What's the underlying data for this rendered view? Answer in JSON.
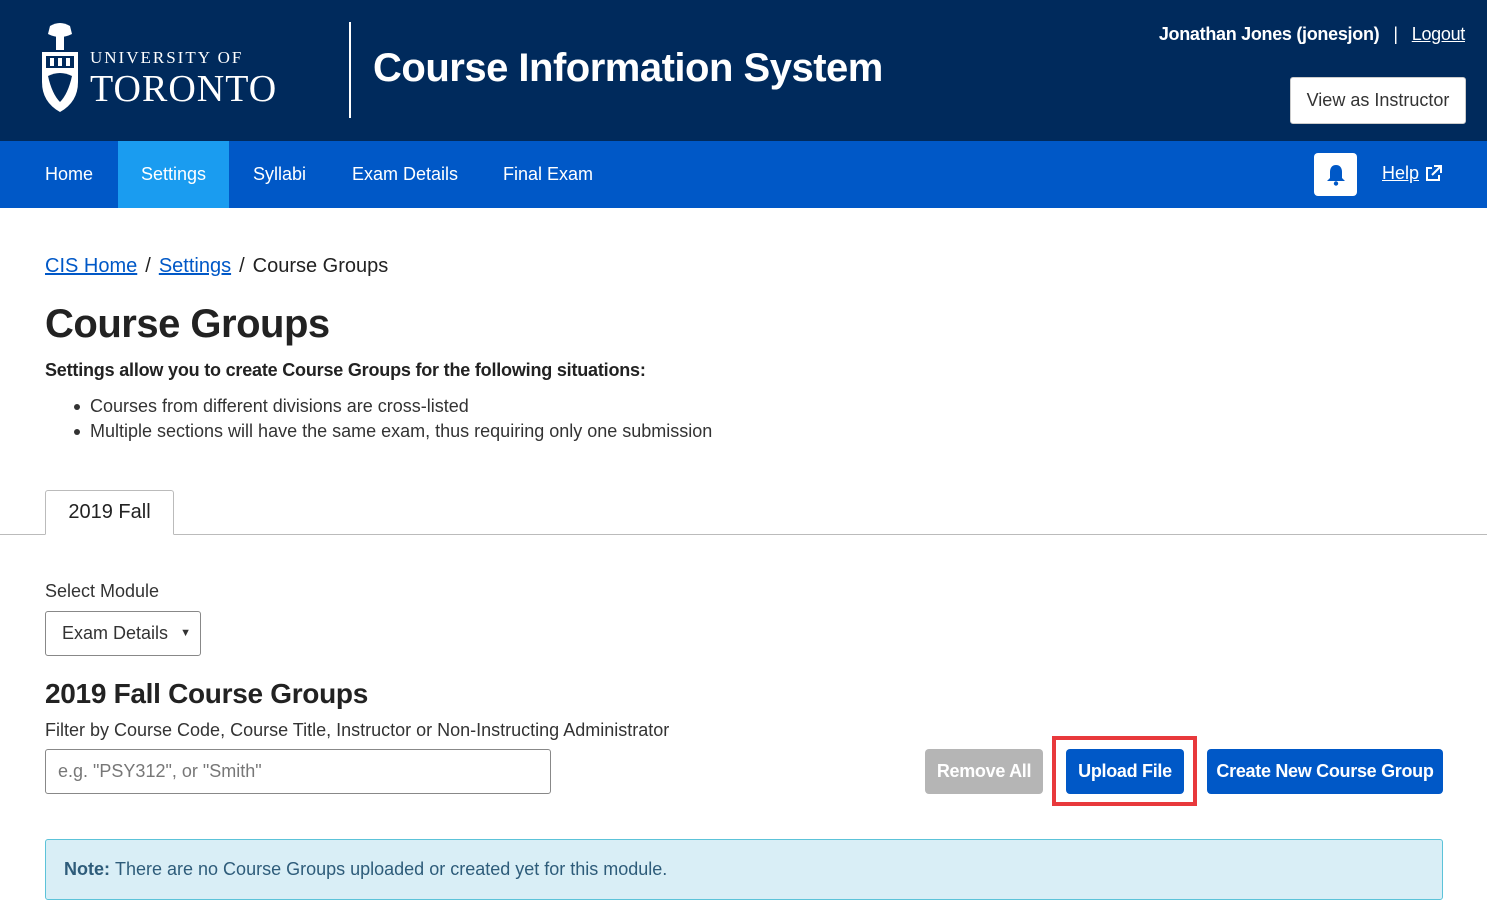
{
  "header": {
    "university_line1": "UNIVERSITY OF",
    "university_line2": "TORONTO",
    "app_title": "Course Information System",
    "user_name": "Jonathan Jones (jonesjon)",
    "separator": "|",
    "logout_label": "Logout",
    "view_as_instructor_label": "View as Instructor"
  },
  "nav": {
    "items": [
      {
        "label": "Home",
        "active": false
      },
      {
        "label": "Settings",
        "active": true
      },
      {
        "label": "Syllabi",
        "active": false
      },
      {
        "label": "Exam Details",
        "active": false
      },
      {
        "label": "Final Exam",
        "active": false
      }
    ],
    "help_label": "Help",
    "bell_icon": "bell-icon",
    "external_icon": "external-link-icon"
  },
  "breadcrumb": {
    "items": [
      "CIS Home",
      "Settings"
    ],
    "separator": "/",
    "current": "Course Groups"
  },
  "main": {
    "title": "Course Groups",
    "intro": "Settings allow you to create Course Groups for the following situations:",
    "bullets": [
      "Courses from different divisions are cross-listed",
      "Multiple sections will have the same exam, thus requiring only one submission"
    ],
    "tabs": [
      {
        "label": "2019 Fall",
        "active": true
      }
    ],
    "module_label": "Select Module",
    "module_selected": "Exam Details",
    "groups_title": "2019 Fall Course Groups",
    "filter_label": "Filter by Course Code, Course Title, Instructor or Non-Instructing Administrator",
    "filter_placeholder": "e.g. \"PSY312\", or \"Smith\"",
    "filter_value": "",
    "buttons": {
      "remove_all": "Remove All",
      "upload_file": "Upload File",
      "create_new": "Create New Course Group"
    },
    "note_label": "Note:",
    "note_text": "There are no Course Groups uploaded or created yet for this module."
  },
  "colors": {
    "header_bg": "#002a5c",
    "nav_bg": "#0058c7",
    "nav_active": "#1a9cf0",
    "primary_button": "#0058c7",
    "disabled_button": "#b5b5b5",
    "highlight_border": "#e8393c",
    "note_bg": "#d9eef6"
  }
}
